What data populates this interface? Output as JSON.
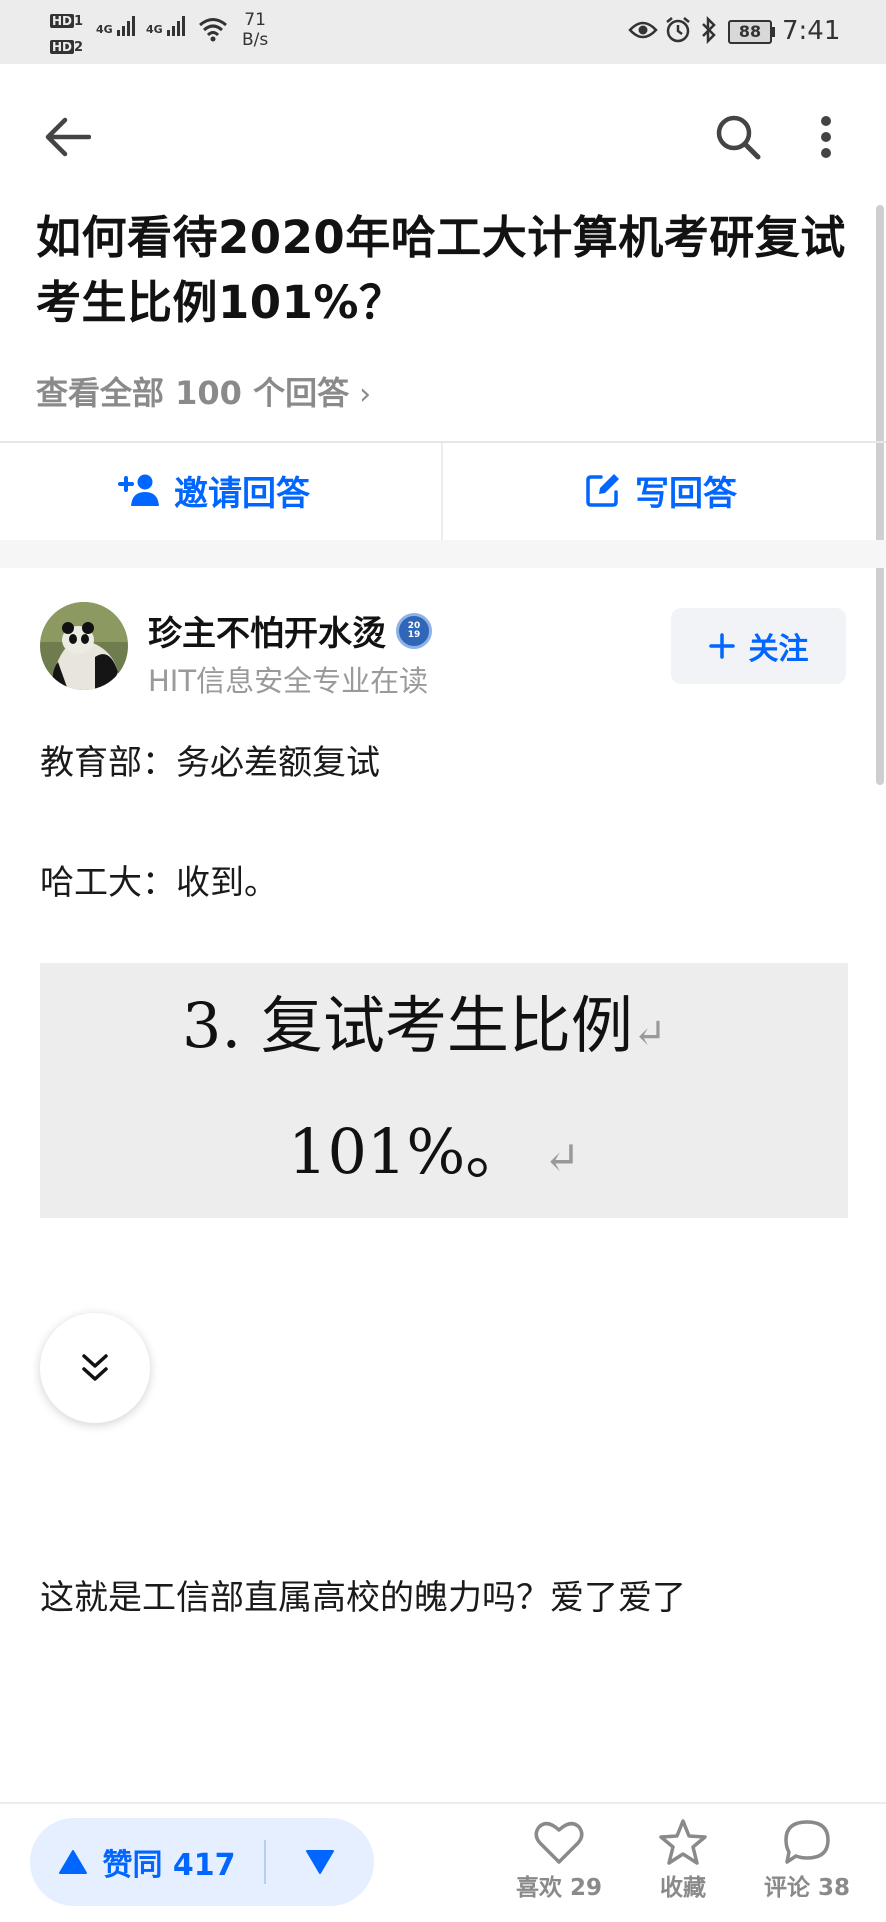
{
  "status_bar": {
    "network_speed_value": "71",
    "network_speed_unit": "B/s",
    "battery": "88",
    "time": "7:41",
    "hd_label": "HD",
    "hd1_sub": "1",
    "hd2_sub": "2",
    "signal_label": "4G"
  },
  "header": {
    "back_icon": "arrow-left-icon",
    "search_icon": "search-icon",
    "more_icon": "more-vertical-icon"
  },
  "question": {
    "title": "如何看待2020年哈工大计算机考研复试考生比例101%？",
    "view_all": "查看全部 100 个回答",
    "view_all_chevron": "›"
  },
  "actions": {
    "invite": "邀请回答",
    "write": "写回答"
  },
  "answer": {
    "author_name": "珍主不怕开水烫",
    "author_badge": "2019",
    "author_bio": "HIT信息安全专业在读",
    "follow_label": "关注",
    "paragraphs": [
      "教育部：务必差额复试",
      "哈工大：收到。",
      "这就是工信部直属高校的魄力吗？爱了爱了"
    ],
    "image_lines": [
      "3.  复试考生比例",
      "101%。"
    ]
  },
  "bottom_bar": {
    "vote_up": "赞同 417",
    "like": "喜欢 29",
    "favorite": "收藏",
    "comment": "评论 38"
  },
  "colors": {
    "accent": "#0066ff",
    "vote_bg": "#e5efff",
    "muted": "#8a8a8a"
  }
}
